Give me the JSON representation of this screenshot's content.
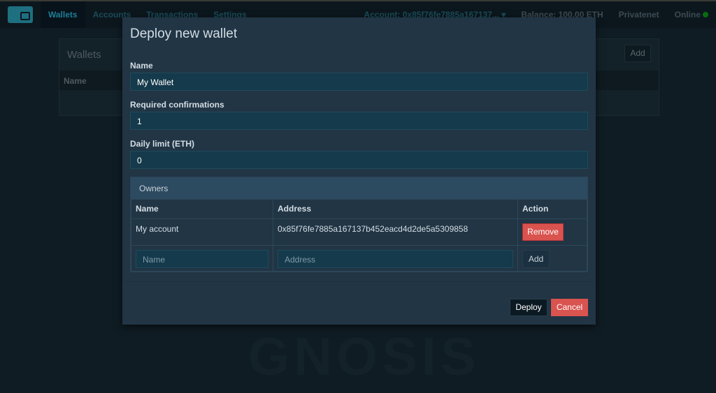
{
  "nav": {
    "items": [
      "Wallets",
      "Accounts",
      "Transactions",
      "Settings"
    ],
    "account": "Account: 0x85f76fe7885a167137... ▾",
    "balance": "Balance: 100.00 ETH",
    "network": "Privatenet",
    "status": "Online"
  },
  "background": {
    "panel_title": "Wallets",
    "add_label": "Add",
    "col_name": "Name",
    "watermark": "GNOSIS"
  },
  "modal": {
    "title": "Deploy new wallet",
    "name_label": "Name",
    "name_value": "My Wallet",
    "confirm_label": "Required confirmations",
    "confirm_value": "1",
    "limit_label": "Daily limit (ETH)",
    "limit_value": "0",
    "owners": {
      "title": "Owners",
      "headers": [
        "Name",
        "Address",
        "Action"
      ],
      "rows": [
        {
          "name": "My account",
          "address": "0x85f76fe7885a167137b452eacd4d2de5a5309858",
          "action": "Remove"
        }
      ],
      "name_placeholder": "Name",
      "address_placeholder": "Address",
      "add_label": "Add"
    },
    "deploy_label": "Deploy",
    "cancel_label": "Cancel"
  },
  "colors": {
    "accent": "#1d7f95",
    "danger": "#d9534f",
    "online": "#0a6a10"
  }
}
